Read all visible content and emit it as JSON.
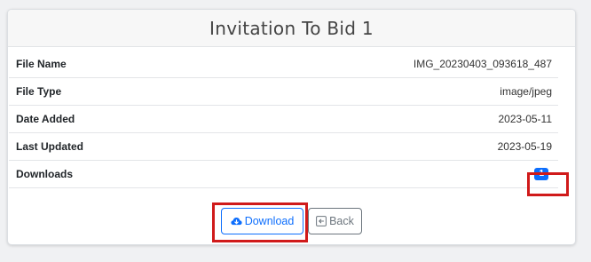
{
  "card": {
    "title": "Invitation To Bid 1"
  },
  "details": [
    {
      "label": "File Name",
      "value": "IMG_20230403_093618_487"
    },
    {
      "label": "File Type",
      "value": "image/jpeg"
    },
    {
      "label": "Date Added",
      "value": "2023-05-11"
    },
    {
      "label": "Last Updated",
      "value": "2023-05-19"
    },
    {
      "label": "Downloads",
      "value": "1"
    }
  ],
  "buttons": {
    "download_label": "Download",
    "back_label": "Back"
  },
  "colors": {
    "primary": "#0d6efd",
    "secondary": "#6c757d",
    "highlight": "#d01a1a"
  },
  "icons": {
    "download": "cloud-download-icon",
    "back": "back-arrow-icon"
  }
}
